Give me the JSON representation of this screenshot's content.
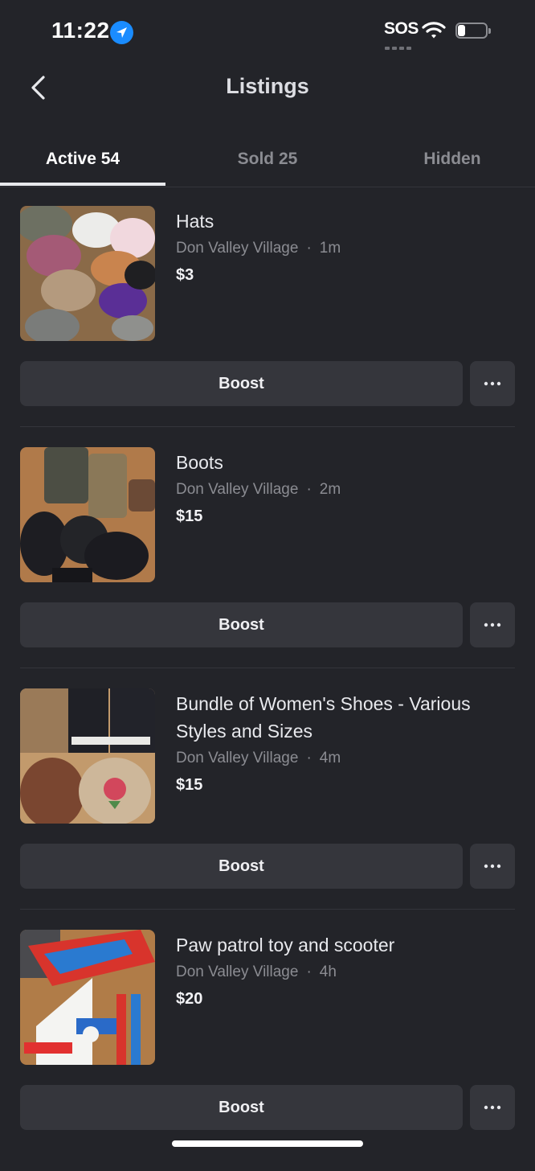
{
  "status_bar": {
    "time": "11:22",
    "sos": "SOS",
    "battery_level": 0.25
  },
  "header": {
    "title": "Listings",
    "back_icon": "chevron-left-icon"
  },
  "tabs": [
    {
      "label": "Active 54",
      "active": true
    },
    {
      "label": "Sold 25",
      "active": false
    },
    {
      "label": "Hidden",
      "active": false
    }
  ],
  "listings": [
    {
      "title": "Hats",
      "location": "Don Valley Village",
      "separator": "·",
      "age": "1m",
      "price": "$3",
      "boost_label": "Boost",
      "more_icon": "more-horizontal-icon"
    },
    {
      "title": "Boots",
      "location": "Don Valley Village",
      "separator": "·",
      "age": "2m",
      "price": "$15",
      "boost_label": "Boost",
      "more_icon": "more-horizontal-icon"
    },
    {
      "title": "Bundle of Women's Shoes - Various Styles and Sizes",
      "location": "Don Valley Village",
      "separator": "·",
      "age": "4m",
      "price": "$15",
      "boost_label": "Boost",
      "more_icon": "more-horizontal-icon"
    },
    {
      "title": "Paw patrol toy and scooter",
      "location": "Don Valley Village",
      "separator": "·",
      "age": "4h",
      "price": "$20",
      "boost_label": "Boost",
      "more_icon": "more-horizontal-icon"
    }
  ],
  "colors": {
    "background": "#232429",
    "button": "#35363c",
    "muted_text": "#8b8c92",
    "location_blue": "#1a8cff"
  }
}
